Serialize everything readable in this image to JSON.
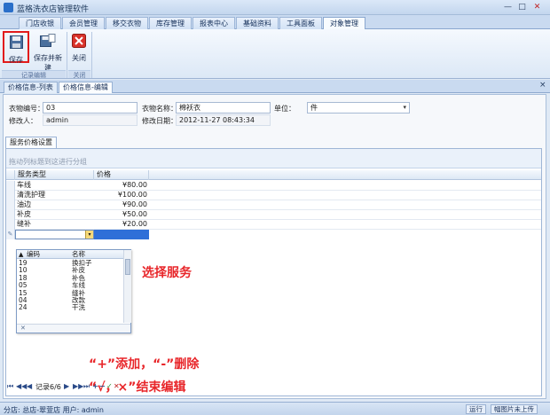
{
  "window": {
    "title": "蓝格洗衣店管理软件",
    "min": "—",
    "max": "□",
    "close": "✕"
  },
  "ribbon_tabs": [
    {
      "label": "门店收银",
      "active": false
    },
    {
      "label": "会员管理",
      "active": false
    },
    {
      "label": "移交衣物",
      "active": false
    },
    {
      "label": "库存管理",
      "active": false
    },
    {
      "label": "报表中心",
      "active": false
    },
    {
      "label": "基础资料",
      "active": false
    },
    {
      "label": "工具面板",
      "active": false
    },
    {
      "label": "对象管理",
      "active": true
    }
  ],
  "ribbon": {
    "save": "保存",
    "save_new": "保存并新建",
    "close": "关闭",
    "group_record": "记录编辑",
    "group_close": "关闭"
  },
  "doc_tabs": [
    {
      "label": "价格信息-列表",
      "active": false
    },
    {
      "label": "价格信息-编辑",
      "active": true
    }
  ],
  "form": {
    "code_label": "衣物编号：",
    "code_value": "03",
    "name_label": "衣物名称：",
    "name_value": "棉袄衣",
    "unit_label": "单位：",
    "unit_value": "件",
    "modifier_label": "修改人：",
    "modifier_value": "admin",
    "date_label": "修改日期：",
    "date_value": "2012-11-27 08:43:34"
  },
  "grid": {
    "tab_label": "服务价格设置",
    "group_hint": "拖动列标题到这进行分组",
    "headers": [
      "服务类型",
      "价格"
    ],
    "rows": [
      {
        "service": "车线",
        "price": "¥80.00"
      },
      {
        "service": "清洗护理",
        "price": "¥100.00"
      },
      {
        "service": "油边",
        "price": "¥90.00"
      },
      {
        "service": "补皮",
        "price": "¥50.00"
      },
      {
        "service": "缝补",
        "price": "¥20.00"
      }
    ]
  },
  "popup": {
    "headers": [
      "编码",
      "名称"
    ],
    "rows": [
      {
        "code": "19",
        "name": "换扣子"
      },
      {
        "code": "10",
        "name": "补皮"
      },
      {
        "code": "18",
        "name": "补色"
      },
      {
        "code": "05",
        "name": "车线"
      },
      {
        "code": "15",
        "name": "缝补"
      },
      {
        "code": "04",
        "name": "改款"
      },
      {
        "code": "24",
        "name": "干洗"
      }
    ],
    "clear": "✕"
  },
  "annotations": {
    "select_service": "选择服务",
    "add_delete": "“+”添加，“-”删除",
    "end_edit": "“√，×”结束编辑"
  },
  "navbar": {
    "record": "记录6/6"
  },
  "status": {
    "text": "分店: 总店-翠萱店  用户: admin",
    "online": "运行",
    "upload": "幅图片未上传"
  }
}
